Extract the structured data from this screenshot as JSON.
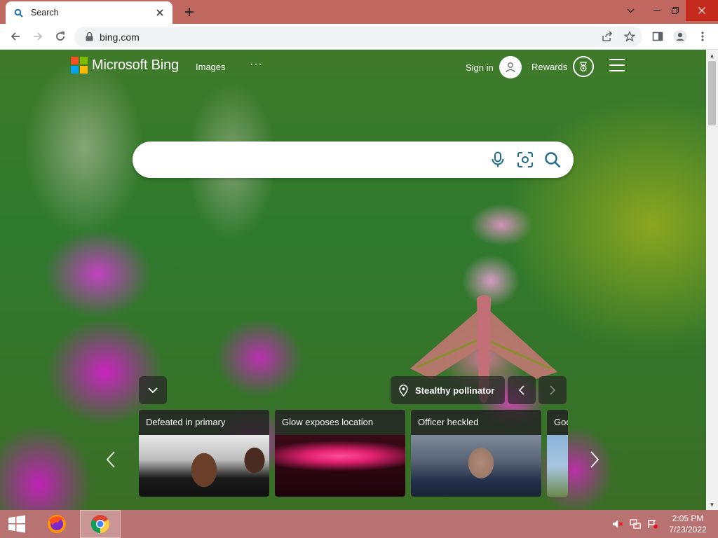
{
  "browser": {
    "tab_title": "Search",
    "url": "bing.com"
  },
  "bing": {
    "brand": "Microsoft Bing",
    "nav_images": "Images",
    "nav_more": "···",
    "sign_in": "Sign in",
    "rewards": "Rewards",
    "search": {
      "value": "",
      "placeholder": ""
    },
    "image_of_day": {
      "title": "Stealthy pollinator"
    },
    "news": [
      {
        "title": "Defeated in primary"
      },
      {
        "title": "Glow exposes location"
      },
      {
        "title": "Officer heckled"
      },
      {
        "title": "Goo"
      }
    ]
  },
  "taskbar": {
    "apps": [
      "firefox-icon",
      "chrome-icon"
    ],
    "clock_time": "2:05 PM",
    "clock_date": "7/23/2022"
  },
  "colors": {
    "tabstrip": "#c0675f",
    "taskbar": "#b87272",
    "search_icon": "#1c6b8f",
    "ms_red": "#f25022",
    "ms_green": "#7fba00",
    "ms_blue": "#00a4ef",
    "ms_yellow": "#ffb900"
  }
}
